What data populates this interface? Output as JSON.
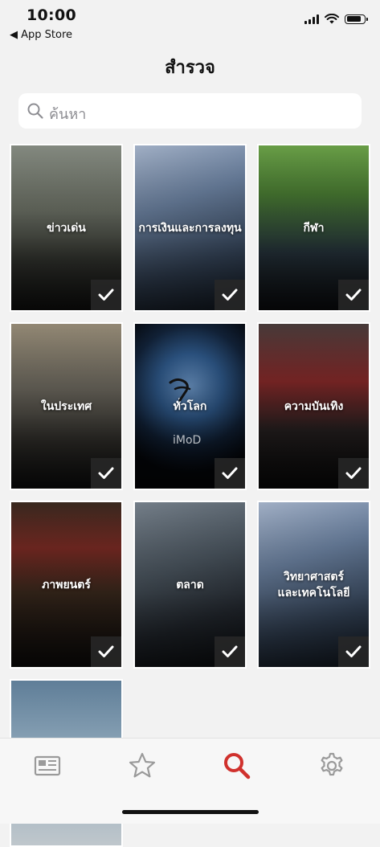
{
  "status_bar": {
    "time": "10:00",
    "back_label": "◀ App Store"
  },
  "header": {
    "title": "สำรวจ"
  },
  "search": {
    "placeholder": "ค้นหา",
    "icon": "search-icon"
  },
  "categories": [
    {
      "id": "headlines",
      "label": "ข่าวเด่น",
      "selected": true,
      "bg": "linear-gradient(180deg,#8a9086 0%,#6f7468 40%,#3b3d37 70%,#1a1a18 100%)"
    },
    {
      "id": "finance",
      "label": "การเงินและการลงทุน",
      "selected": true,
      "bg": "linear-gradient(160deg,#a9b8cf 0%,#6f86a6 35%,#3e5068 70%,#1f2a38 100%)"
    },
    {
      "id": "sport",
      "label": "กีฬา",
      "selected": true,
      "bg": "linear-gradient(180deg,#6ea64a 0%,#4a7d33 30%,#2b3a44 65%,#121418 100%)"
    },
    {
      "id": "domestic",
      "label": "ในประเทศ",
      "selected": true,
      "bg": "linear-gradient(180deg,#9a8f7a 0%,#6e6a60 40%,#3a3833 70%,#151515 100%)"
    },
    {
      "id": "world",
      "label": "ทั่วโลก",
      "selected": true,
      "bg": "radial-gradient(circle at 50% 38%,#6d98c9 0%,#2f5a8c 28%,#12233a 52%,#05070c 75%)"
    },
    {
      "id": "entertainment",
      "label": "ความบันเทิง",
      "selected": true,
      "bg": "linear-gradient(180deg,#4a3d3c 0%,#8a2a2a 35%,#2a2424 65%,#0e0e0e 100%)"
    },
    {
      "id": "movies",
      "label": "ภาพยนตร์",
      "selected": true,
      "bg": "linear-gradient(180deg,#3b2a20 0%,#7c2b24 28%,#3e2c1f 55%,#151210 100%)"
    },
    {
      "id": "markets",
      "label": "ตลาด",
      "selected": true,
      "bg": "linear-gradient(160deg,#7a8590 0%,#4d5862 40%,#2a3038 70%,#121519 100%)"
    },
    {
      "id": "science_tech",
      "label": "วิทยาศาสตร์\nและเทคโนโลยี",
      "selected": true,
      "bg": "linear-gradient(160deg,#a9b8cf 0%,#6f86a6 35%,#3e5068 70%,#1f2a38 100%)"
    },
    {
      "id": "partial",
      "label": "",
      "selected": false,
      "bg": "linear-gradient(180deg,#5f7e98 0%,#8aa3b6 40%,#bfc7cc 100%)"
    }
  ],
  "watermark": {
    "text": "iMoD"
  },
  "tabbar": {
    "active": "explore",
    "items": [
      {
        "id": "news",
        "icon": "newspaper-icon"
      },
      {
        "id": "favorites",
        "icon": "star-icon"
      },
      {
        "id": "explore",
        "icon": "search-icon"
      },
      {
        "id": "settings",
        "icon": "gear-icon"
      }
    ],
    "active_color": "#d0312d",
    "inactive_color": "#9a9a9a"
  }
}
